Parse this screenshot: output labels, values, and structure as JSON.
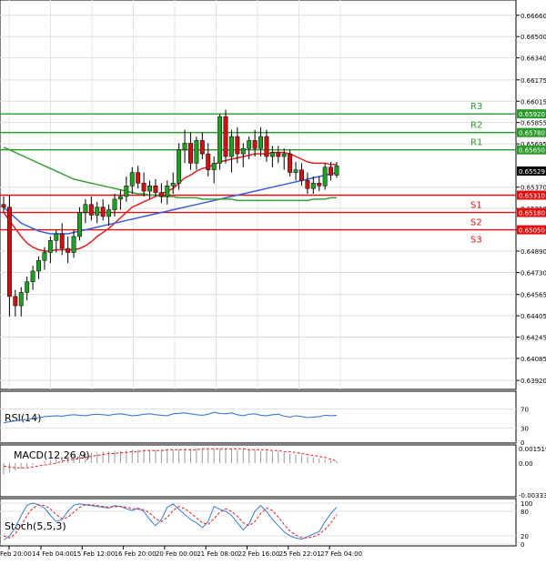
{
  "chart_data": [
    {
      "type": "candlestick",
      "price_axis": {
        "ticks": [
          "0.66660",
          "0.66500",
          "0.66340",
          "0.66175",
          "0.66015",
          "0.65855",
          "0.65695",
          "0.65370",
          "0.65210",
          "0.65050",
          "0.64890",
          "0.64730",
          "0.64565",
          "0.64405",
          "0.64245",
          "0.64085",
          "0.63920"
        ],
        "ylim": [
          0.639,
          0.6672
        ]
      },
      "current_price": "0.65529",
      "levels": [
        {
          "name": "R3",
          "value": 0.6592,
          "label": "0.65920",
          "color": "#2a9a2a"
        },
        {
          "name": "R2",
          "value": 0.6578,
          "label": "0.65780",
          "color": "#2a9a2a"
        },
        {
          "name": "R1",
          "value": 0.6565,
          "label": "0.65650",
          "color": "#2a9a2a"
        },
        {
          "name": "S1",
          "value": 0.6531,
          "label": "0.65310",
          "color": "#e01010"
        },
        {
          "name": "S2",
          "value": 0.6518,
          "label": "0.65180",
          "color": "#e01010"
        },
        {
          "name": "S3",
          "value": 0.6505,
          "label": "0.65050",
          "color": "#e01010"
        }
      ],
      "time_axis": [
        "Feb 20:00",
        "14 Feb 04:00",
        "15 Feb 12:00",
        "16 Feb 20:00",
        "20 Feb 00:00",
        "21 Feb 08:00",
        "22 Feb 16:00",
        "25 Feb 22:01",
        "27 Feb 04:00"
      ],
      "candles": [
        [
          0.6524,
          0.653,
          0.6518,
          0.6522
        ],
        [
          0.6522,
          0.6531,
          0.644,
          0.6455
        ],
        [
          0.6455,
          0.646,
          0.644,
          0.6448
        ],
        [
          0.6448,
          0.6462,
          0.644,
          0.6458
        ],
        [
          0.6458,
          0.647,
          0.6452,
          0.6466
        ],
        [
          0.6466,
          0.6478,
          0.646,
          0.6474
        ],
        [
          0.6474,
          0.6485,
          0.6468,
          0.6482
        ],
        [
          0.6482,
          0.6492,
          0.6475,
          0.6488
        ],
        [
          0.6488,
          0.65,
          0.648,
          0.6497
        ],
        [
          0.6497,
          0.6505,
          0.6488,
          0.6502
        ],
        [
          0.6502,
          0.651,
          0.6486,
          0.6491
        ],
        [
          0.6491,
          0.65,
          0.648,
          0.6488
        ],
        [
          0.6488,
          0.6505,
          0.6484,
          0.65
        ],
        [
          0.65,
          0.6522,
          0.6497,
          0.6518
        ],
        [
          0.6518,
          0.6528,
          0.651,
          0.6524
        ],
        [
          0.6524,
          0.653,
          0.6512,
          0.6516
        ],
        [
          0.6516,
          0.6526,
          0.651,
          0.6522
        ],
        [
          0.6522,
          0.6528,
          0.6512,
          0.6515
        ],
        [
          0.6515,
          0.6524,
          0.6508,
          0.652
        ],
        [
          0.652,
          0.6532,
          0.6515,
          0.6528
        ],
        [
          0.6528,
          0.6535,
          0.652,
          0.653
        ],
        [
          0.653,
          0.6545,
          0.6526,
          0.6538
        ],
        [
          0.6538,
          0.6552,
          0.6532,
          0.6548
        ],
        [
          0.6548,
          0.6553,
          0.6536,
          0.654
        ],
        [
          0.654,
          0.6548,
          0.653,
          0.6534
        ],
        [
          0.6534,
          0.6542,
          0.6528,
          0.6538
        ],
        [
          0.6538,
          0.6543,
          0.653,
          0.6533
        ],
        [
          0.6533,
          0.654,
          0.6525,
          0.653
        ],
        [
          0.653,
          0.6542,
          0.6524,
          0.6538
        ],
        [
          0.6538,
          0.6548,
          0.6532,
          0.654
        ],
        [
          0.654,
          0.657,
          0.6535,
          0.6565
        ],
        [
          0.6565,
          0.658,
          0.6555,
          0.657
        ],
        [
          0.657,
          0.6578,
          0.655,
          0.6555
        ],
        [
          0.6555,
          0.6575,
          0.655,
          0.6572
        ],
        [
          0.6572,
          0.6578,
          0.6558,
          0.6562
        ],
        [
          0.6562,
          0.657,
          0.6545,
          0.655
        ],
        [
          0.655,
          0.656,
          0.654,
          0.6555
        ],
        [
          0.6555,
          0.6592,
          0.655,
          0.659
        ],
        [
          0.659,
          0.6595,
          0.6555,
          0.656
        ],
        [
          0.656,
          0.658,
          0.6548,
          0.6575
        ],
        [
          0.6575,
          0.6582,
          0.6555,
          0.6562
        ],
        [
          0.6562,
          0.657,
          0.6552,
          0.6566
        ],
        [
          0.6566,
          0.6575,
          0.6558,
          0.6572
        ],
        [
          0.6572,
          0.658,
          0.656,
          0.6566
        ],
        [
          0.6566,
          0.6582,
          0.656,
          0.6575
        ],
        [
          0.6575,
          0.658,
          0.6556,
          0.656
        ],
        [
          0.656,
          0.6568,
          0.6552,
          0.6563
        ],
        [
          0.6563,
          0.6568,
          0.6555,
          0.656
        ],
        [
          0.656,
          0.6566,
          0.655,
          0.6562
        ],
        [
          0.6562,
          0.6565,
          0.6545,
          0.6548
        ],
        [
          0.6548,
          0.6556,
          0.6542,
          0.655
        ],
        [
          0.655,
          0.6555,
          0.6538,
          0.6542
        ],
        [
          0.6542,
          0.6548,
          0.6532,
          0.6536
        ],
        [
          0.6536,
          0.6545,
          0.6532,
          0.654
        ],
        [
          0.654,
          0.6545,
          0.6534,
          0.6538
        ],
        [
          0.6538,
          0.6555,
          0.6535,
          0.6552
        ],
        [
          0.6552,
          0.6556,
          0.6542,
          0.6546
        ],
        [
          0.6546,
          0.6556,
          0.6544,
          0.6553
        ]
      ],
      "moving_averages": [
        {
          "color": "#e02020",
          "values": [
            0.6518,
            0.6512,
            0.6506,
            0.65,
            0.6495,
            0.6492,
            0.649,
            0.6489,
            0.6489,
            0.649,
            0.649,
            0.649,
            0.649,
            0.6491,
            0.6493,
            0.6496,
            0.65,
            0.6503,
            0.6506,
            0.651,
            0.6514,
            0.6518,
            0.6522,
            0.6524,
            0.6526,
            0.6528,
            0.653,
            0.6532,
            0.6534,
            0.6536,
            0.654,
            0.6544,
            0.6546,
            0.6549,
            0.6551,
            0.6552,
            0.6554,
            0.6556,
            0.6557,
            0.6558,
            0.6559,
            0.656,
            0.6561,
            0.6562,
            0.6562,
            0.6562,
            0.6563,
            0.6563,
            0.6563,
            0.6562,
            0.656,
            0.6558,
            0.6556,
            0.6555,
            0.6555,
            0.6555,
            0.6554,
            0.6554
          ]
        },
        {
          "color": "#3a5fd8",
          "values": [
            0.6522,
            0.6518,
            0.6514,
            0.651,
            0.6508,
            0.6506,
            0.6504,
            0.6503,
            0.6502,
            0.6502,
            0.6502,
            0.6502,
            0.6503,
            0.6504,
            0.6505,
            0.6506,
            0.6507,
            0.6508,
            0.6509,
            0.651,
            0.6511,
            0.6512,
            0.6513,
            0.6514,
            0.6515,
            0.6516,
            0.6517,
            0.6518,
            0.6519,
            0.652,
            0.6521,
            0.6522,
            0.6523,
            0.6524,
            0.6525,
            0.6526,
            0.6527,
            0.6528,
            0.6529,
            0.653,
            0.6531,
            0.6532,
            0.6533,
            0.6534,
            0.6535,
            0.6536,
            0.6537,
            0.6538,
            0.6539,
            0.654,
            0.6541,
            0.6542,
            0.6543,
            0.6544,
            0.6545,
            0.6546,
            0.6547,
            0.6548
          ]
        },
        {
          "color": "#3aa03a",
          "values": [
            0.6567,
            0.6565,
            0.6563,
            0.6561,
            0.6559,
            0.6557,
            0.6555,
            0.6553,
            0.6551,
            0.6549,
            0.6547,
            0.6545,
            0.6543,
            0.6542,
            0.6541,
            0.654,
            0.6539,
            0.6538,
            0.6537,
            0.6536,
            0.6535,
            0.6534,
            0.6533,
            0.6532,
            0.6532,
            0.6531,
            0.6531,
            0.653,
            0.653,
            0.653,
            0.6529,
            0.6529,
            0.6529,
            0.6529,
            0.6528,
            0.6528,
            0.6528,
            0.6528,
            0.6528,
            0.6528,
            0.6527,
            0.6527,
            0.6527,
            0.6527,
            0.6527,
            0.6527,
            0.6527,
            0.6527,
            0.6527,
            0.6527,
            0.6527,
            0.6527,
            0.6527,
            0.6528,
            0.6528,
            0.6528,
            0.6529,
            0.6529
          ]
        }
      ]
    },
    {
      "type": "line",
      "title": "RSI(14)",
      "ticks": [
        "70",
        "30",
        "0"
      ],
      "ylim": [
        0,
        100
      ],
      "color": "#3a7bd5",
      "values": [
        41,
        43,
        45,
        47,
        48,
        50,
        52,
        54,
        55,
        56,
        55,
        57,
        58,
        57,
        56,
        58,
        59,
        58,
        57,
        59,
        60,
        58,
        56,
        57,
        59,
        60,
        58,
        57,
        56,
        60,
        61,
        62,
        60,
        58,
        57,
        59,
        63,
        61,
        60,
        62,
        58,
        56,
        59,
        60,
        57,
        56,
        58,
        59,
        55,
        53,
        56,
        54,
        52,
        53,
        54,
        57,
        56,
        57
      ]
    },
    {
      "type": "bar",
      "title": "MACD(12,26,9)",
      "ticks": [
        "0.001519",
        "0.00",
        "-0.003331"
      ],
      "ylim": [
        -0.003331,
        0.001519
      ],
      "bar_color": "#999999",
      "signal_color": "#e02020",
      "histogram": [
        -0.0012,
        -0.001,
        -0.0008,
        -0.0006,
        -0.0004,
        -0.0002,
        0.0,
        0.0002,
        0.0003,
        0.0005,
        0.0006,
        0.0007,
        0.0008,
        0.0009,
        0.001,
        0.0011,
        0.0011,
        0.0012,
        0.0012,
        0.0013,
        0.0013,
        0.0013,
        0.0014,
        0.0014,
        0.0014,
        0.0014,
        0.0014,
        0.0014,
        0.0014,
        0.0014,
        0.0014,
        0.0015,
        0.0015,
        0.0015,
        0.0015,
        0.0015,
        0.0015,
        0.0015,
        0.0015,
        0.0015,
        0.0014,
        0.0014,
        0.0014,
        0.0014,
        0.0013,
        0.0013,
        0.0012,
        0.0012,
        0.0011,
        0.001,
        0.0009,
        0.0008,
        0.0007,
        0.0006,
        0.0005,
        0.0004,
        0.0003,
        0.0002
      ],
      "signal": [
        -0.0003,
        -0.0004,
        -0.0005,
        -0.0005,
        -0.0005,
        -0.0004,
        -0.0003,
        -0.0002,
        -0.0001,
        0.0,
        0.0002,
        0.0003,
        0.0004,
        0.0005,
        0.0006,
        0.0007,
        0.0008,
        0.0009,
        0.001,
        0.001,
        0.0011,
        0.0011,
        0.0012,
        0.0012,
        0.0013,
        0.0013,
        0.0013,
        0.0013,
        0.0014,
        0.0014,
        0.0014,
        0.0014,
        0.0014,
        0.0014,
        0.0015,
        0.0015,
        0.0015,
        0.0015,
        0.0015,
        0.0015,
        0.0015,
        0.0015,
        0.0014,
        0.0014,
        0.0014,
        0.0014,
        0.0013,
        0.0013,
        0.0012,
        0.0012,
        0.0011,
        0.001,
        0.0009,
        0.0008,
        0.0007,
        0.0006,
        0.0004,
        0.0002
      ]
    },
    {
      "type": "line",
      "title": "Stoch(5,5,3)",
      "ticks": [
        "100",
        "80",
        "20",
        "0"
      ],
      "ylim": [
        0,
        100
      ],
      "series": [
        {
          "color": "#3a7bd5",
          "values": [
            10,
            20,
            40,
            70,
            95,
            100,
            96,
            88,
            70,
            55,
            60,
            80,
            95,
            98,
            96,
            94,
            92,
            90,
            88,
            94,
            92,
            86,
            82,
            88,
            80,
            60,
            45,
            60,
            90,
            98,
            85,
            72,
            60,
            52,
            40,
            55,
            92,
            85,
            80,
            70,
            52,
            35,
            50,
            80,
            94,
            80,
            60,
            45,
            30,
            20,
            15,
            12,
            18,
            25,
            30,
            55,
            75,
            90
          ]
        },
        {
          "color": "#e02020",
          "values": [
            20,
            15,
            25,
            45,
            70,
            88,
            96,
            94,
            86,
            72,
            62,
            65,
            78,
            90,
            96,
            96,
            94,
            92,
            90,
            91,
            92,
            90,
            87,
            85,
            84,
            76,
            62,
            55,
            65,
            82,
            92,
            87,
            76,
            64,
            52,
            48,
            62,
            78,
            86,
            80,
            68,
            52,
            45,
            55,
            75,
            88,
            82,
            66,
            48,
            32,
            22,
            16,
            15,
            18,
            24,
            36,
            52,
            72
          ]
        }
      ]
    }
  ]
}
